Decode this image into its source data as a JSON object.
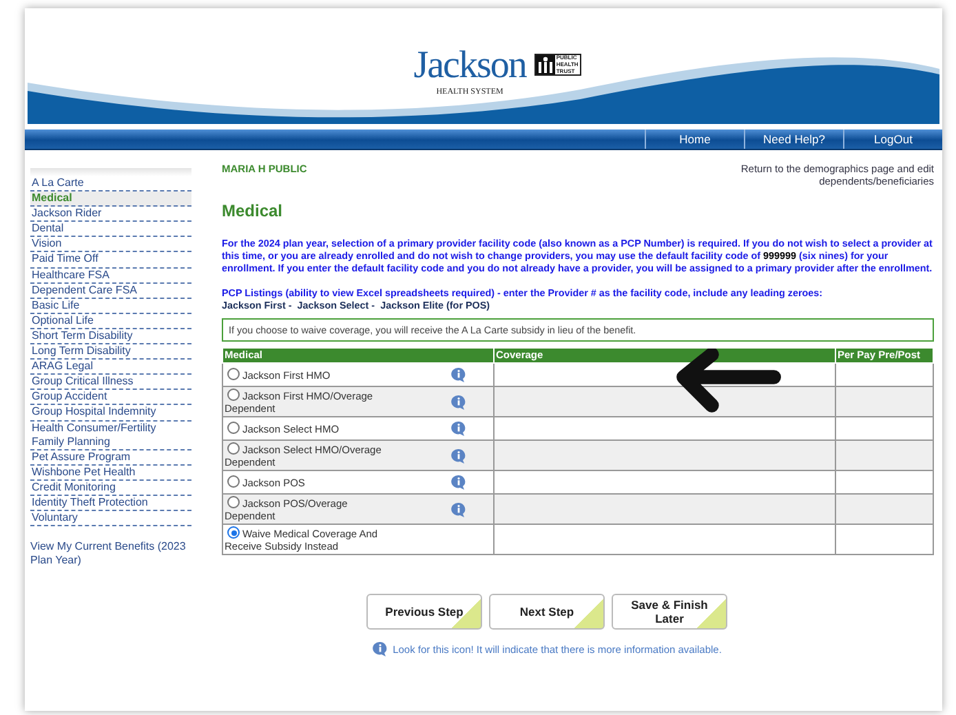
{
  "header": {
    "logo_name": "Jackson",
    "logo_subtitle": "HEALTH SYSTEM",
    "trust_lines": [
      "PUBLIC",
      "HEALTH",
      "TRUST"
    ]
  },
  "nav": [
    "Home",
    "Need Help?",
    "LogOut"
  ],
  "sidebar": {
    "items": [
      {
        "label": "A La Carte",
        "selected": false
      },
      {
        "label": "Medical",
        "selected": true
      },
      {
        "label": "Jackson Rider",
        "selected": false
      },
      {
        "label": "Dental",
        "selected": false
      },
      {
        "label": "Vision",
        "selected": false
      },
      {
        "label": "Paid Time Off",
        "selected": false
      },
      {
        "label": "Healthcare FSA",
        "selected": false
      },
      {
        "label": "Dependent Care FSA",
        "selected": false
      },
      {
        "label": "Basic Life",
        "selected": false
      },
      {
        "label": "Optional Life",
        "selected": false
      },
      {
        "label": "Short Term Disability",
        "selected": false
      },
      {
        "label": "Long Term Disability",
        "selected": false
      },
      {
        "label": "ARAG Legal",
        "selected": false
      },
      {
        "label": "Group Critical Illness",
        "selected": false
      },
      {
        "label": "Group Accident",
        "selected": false
      },
      {
        "label": "Group Hospital Indemnity",
        "selected": false
      },
      {
        "label": "Health Consumer/Fertility Family Planning",
        "selected": false
      },
      {
        "label": "Pet Assure Program",
        "selected": false
      },
      {
        "label": "Wishbone Pet Health",
        "selected": false
      },
      {
        "label": "Credit Monitoring",
        "selected": false
      },
      {
        "label": "Identity Theft Protection",
        "selected": false
      },
      {
        "label": "Voluntary",
        "selected": false
      }
    ],
    "footer_link": "View My Current Benefits (2023 Plan Year)"
  },
  "user_name": "MARIA H PUBLIC",
  "return_link": "Return to the demographics page and edit dependents/beneficiaries",
  "page_title": "Medical",
  "intro": "For the 2024 plan year, selection of a primary provider facility code (also known as a PCP Number) is required. If you do not wish to select a provider at this time, or you are already enrolled and do not wish to change providers, you may use the default facility code of **999999** (six nines) for your enrollment. If you enter the default facility code and you do not already have a provider, you will be assigned to a primary provider after the enrollment.",
  "pcp_note": "PCP Listings (ability to view Excel spreadsheets required) - enter the Provider # as the facility code, include any leading zeroes:",
  "pcp_links": [
    "Jackson First -",
    "Jackson Select -",
    "Jackson Elite (for POS)"
  ],
  "waive_notice": "If you choose to waive coverage, you will receive the A La Carte subsidy in lieu of the benefit.",
  "table": {
    "columns": [
      "Medical",
      "Coverage",
      "Per Pay Pre/Post"
    ],
    "rows": [
      {
        "label": "Jackson First HMO",
        "selected": false,
        "info": true
      },
      {
        "label": "Jackson First HMO/Overage Dependent",
        "selected": false,
        "info": true
      },
      {
        "label": "Jackson Select HMO",
        "selected": false,
        "info": true
      },
      {
        "label": "Jackson Select HMO/Overage Dependent",
        "selected": false,
        "info": true
      },
      {
        "label": "Jackson POS",
        "selected": false,
        "info": true
      },
      {
        "label": "Jackson POS/Overage Dependent",
        "selected": false,
        "info": true
      },
      {
        "label": "Waive Medical Coverage And Receive Subsidy Instead",
        "selected": true,
        "info": false
      }
    ]
  },
  "buttons": [
    "Previous Step",
    "Next Step",
    "Save & Finish Later"
  ],
  "info_hint": "Look for this icon! It will indicate that there is more information available."
}
